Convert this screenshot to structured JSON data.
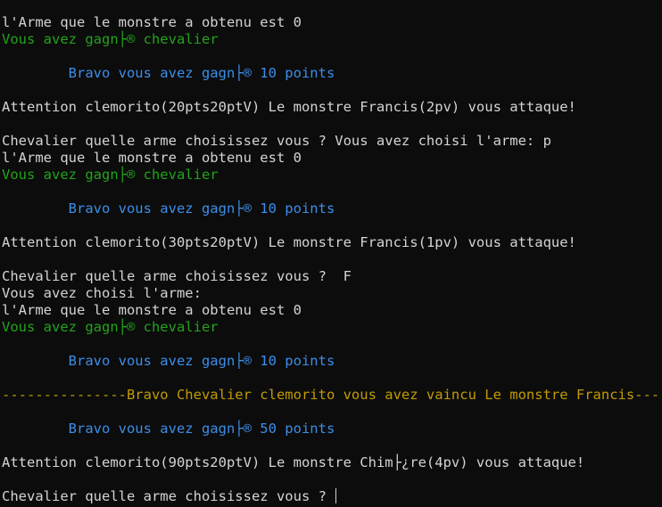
{
  "colors": {
    "background": "#0c0c0c",
    "default_text": "#d4d4d4",
    "green": "#22a31c",
    "blue": "#3b8eea",
    "yellow": "#c19c00"
  },
  "terminal": {
    "lines": [
      {
        "text": "l'Arme que le monstre a obtenu est 0",
        "color": "default"
      },
      {
        "text": "Vous avez gagn├® chevalier",
        "color": "green"
      },
      {
        "text": "",
        "color": "default"
      },
      {
        "text": "        Bravo vous avez gagn├® 10 points",
        "color": "blue"
      },
      {
        "text": "",
        "color": "default"
      },
      {
        "text": "Attention clemorito(20pts20ptV) Le monstre Francis(2pv) vous attaque!",
        "color": "default"
      },
      {
        "text": "",
        "color": "default"
      },
      {
        "text": "Chevalier quelle arme choisissez vous ? Vous avez choisi l'arme: p",
        "color": "default"
      },
      {
        "text": "l'Arme que le monstre a obtenu est 0",
        "color": "default"
      },
      {
        "text": "Vous avez gagn├® chevalier",
        "color": "green"
      },
      {
        "text": "",
        "color": "default"
      },
      {
        "text": "        Bravo vous avez gagn├® 10 points",
        "color": "blue"
      },
      {
        "text": "",
        "color": "default"
      },
      {
        "text": "Attention clemorito(30pts20ptV) Le monstre Francis(1pv) vous attaque!",
        "color": "default"
      },
      {
        "text": "",
        "color": "default"
      },
      {
        "text": "Chevalier quelle arme choisissez vous ?  F",
        "color": "default"
      },
      {
        "text": "Vous avez choisi l'arme:",
        "color": "default"
      },
      {
        "text": "l'Arme que le monstre a obtenu est 0",
        "color": "default"
      },
      {
        "text": "Vous avez gagn├® chevalier",
        "color": "green"
      },
      {
        "text": "",
        "color": "default"
      },
      {
        "text": "        Bravo vous avez gagn├® 10 points",
        "color": "blue"
      },
      {
        "text": "",
        "color": "default"
      },
      {
        "text": "---------------Bravo Chevalier clemorito vous avez vaincu Le monstre Francis-------",
        "color": "yellow"
      },
      {
        "text": "",
        "color": "default"
      },
      {
        "text": "        Bravo vous avez gagn├® 50 points",
        "color": "blue"
      },
      {
        "text": "",
        "color": "default"
      },
      {
        "text": "Attention clemorito(90pts20ptV) Le monstre Chim├¿re(4pv) vous attaque!",
        "color": "default"
      },
      {
        "text": "",
        "color": "default"
      },
      {
        "text": "Chevalier quelle arme choisissez vous ? ",
        "color": "default",
        "prompt": true
      }
    ]
  }
}
